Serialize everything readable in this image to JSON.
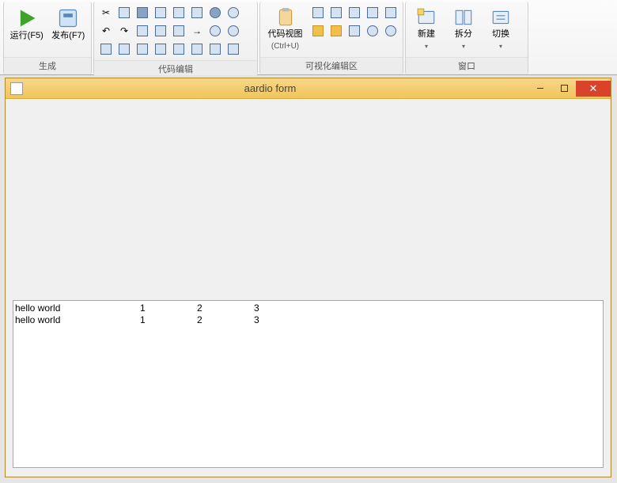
{
  "ribbon": {
    "groups": {
      "build": {
        "label": "生成",
        "run": {
          "label": "运行(F5)"
        },
        "publish": {
          "label": "发布(F7)"
        }
      },
      "edit": {
        "label": "代码编辑"
      },
      "visual": {
        "label": "可视化编辑区",
        "codeview": {
          "line1": "代码视图",
          "line2": "(Ctrl+U)"
        }
      },
      "window": {
        "label": "窗口",
        "new": {
          "label": "新建"
        },
        "split": {
          "label": "拆分"
        },
        "switch": {
          "label": "切换"
        }
      }
    }
  },
  "form": {
    "title": "aardio form",
    "listview": {
      "rows": [
        {
          "c0": "hello world",
          "c1": "1",
          "c2": "2",
          "c3": "3"
        },
        {
          "c0": "hello world",
          "c1": "1",
          "c2": "2",
          "c3": "3"
        }
      ]
    }
  }
}
